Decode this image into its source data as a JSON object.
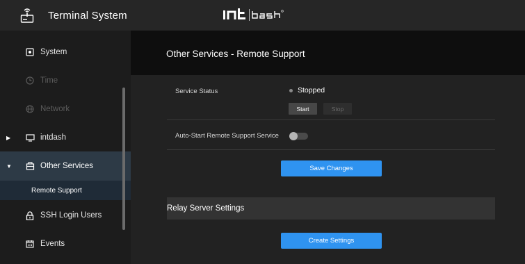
{
  "app": {
    "title": "Terminal System",
    "icon": "terminal-device-icon",
    "logo_text": "intdash"
  },
  "sidebar": {
    "items": [
      {
        "label": "System",
        "icon": "system-icon",
        "state": "normal"
      },
      {
        "label": "Time",
        "icon": "clock-icon",
        "state": "disabled"
      },
      {
        "label": "Network",
        "icon": "globe-icon",
        "state": "disabled"
      },
      {
        "label": "intdash",
        "icon": "display-icon",
        "state": "collapsed"
      },
      {
        "label": "Other Services",
        "icon": "services-icon",
        "state": "expanded"
      },
      {
        "label": "SSH Login Users",
        "icon": "lock-icon",
        "state": "normal"
      },
      {
        "label": "Events",
        "icon": "calendar-icon",
        "state": "normal"
      }
    ],
    "sub_items": [
      {
        "label": "Remote Support",
        "parent": "Other Services",
        "selected": true
      }
    ]
  },
  "main": {
    "title": "Other Services - Remote Support",
    "service_status": {
      "label": "Service Status",
      "value": "Stopped",
      "start_label": "Start",
      "stop_label": "Stop"
    },
    "auto_start": {
      "label": "Auto-Start Remote Support Service",
      "enabled": false
    },
    "save_label": "Save Changes",
    "relay_section": {
      "title": "Relay Server Settings",
      "create_label": "Create Settings"
    }
  },
  "colors": {
    "accent": "#2f93f0",
    "active_nav": "#2d3a46",
    "sub_nav": "#1f2b37",
    "status_stopped": "#8a8a8a"
  }
}
